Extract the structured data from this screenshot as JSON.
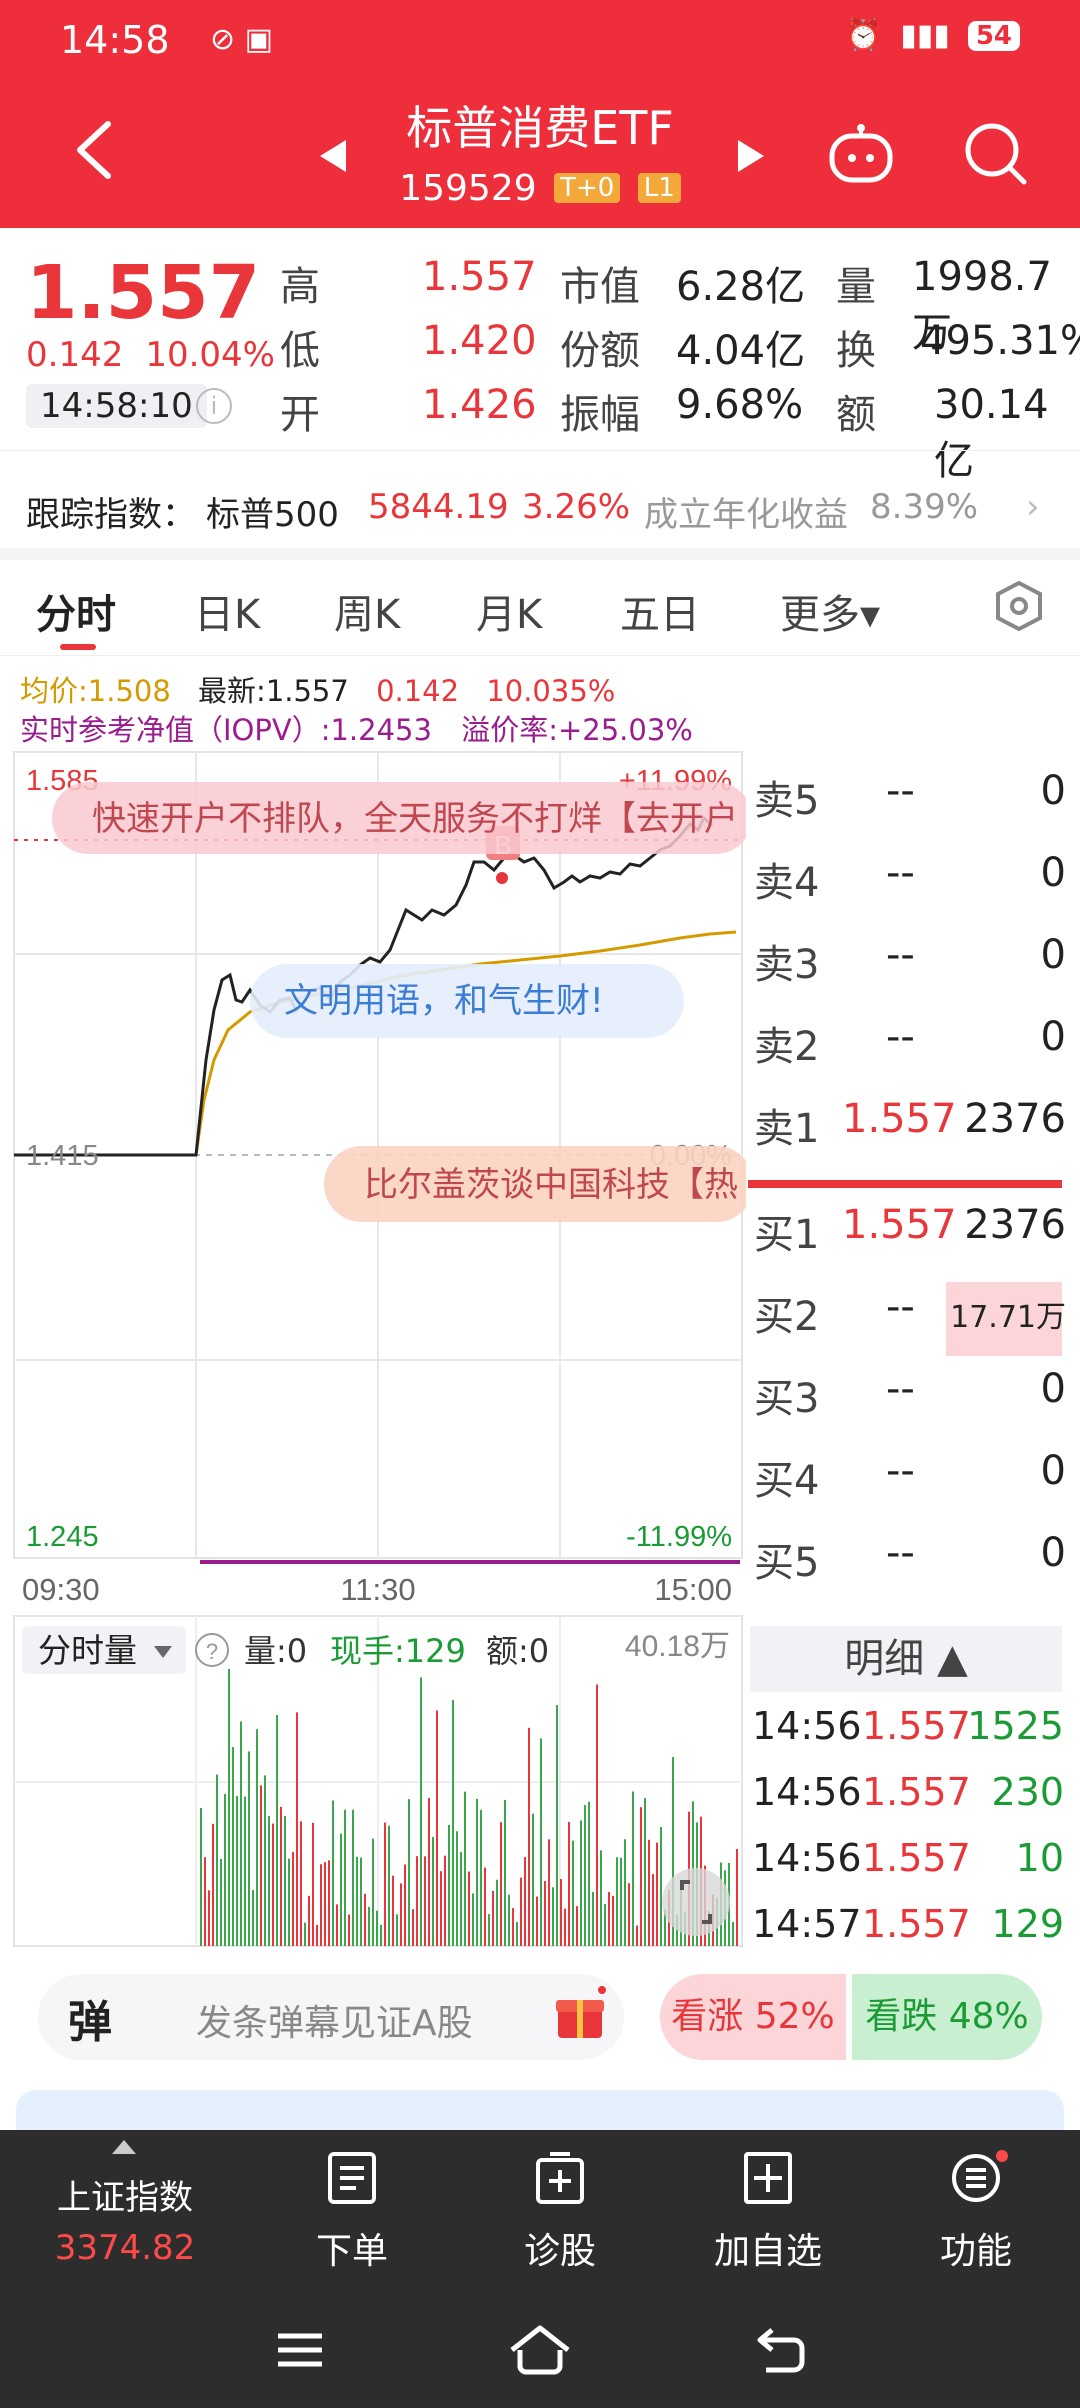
{
  "status": {
    "time": "14:58",
    "battery": "54"
  },
  "header": {
    "title": "标普消费ETF",
    "code": "159529",
    "tags": [
      "T+0",
      "L1"
    ]
  },
  "quote": {
    "price": "1.557",
    "change": "0.142",
    "change_pct": "10.04%",
    "time": "14:58:10",
    "high_label": "高",
    "high": "1.557",
    "low_label": "低",
    "low": "1.420",
    "open_label": "开",
    "open": "1.426",
    "mktcap_label": "市值",
    "mktcap": "6.28亿",
    "share_label": "份额",
    "share": "4.04亿",
    "amp_label": "振幅",
    "amp": "9.68%",
    "vol_label": "量",
    "vol": "1998.7万",
    "turnover_label": "换",
    "turnover": "495.31%",
    "amount_label": "额",
    "amount": "30.14亿"
  },
  "tracking": {
    "label": "跟踪指数：",
    "index": "标普500",
    "value": "5844.19",
    "pct": "3.26%",
    "annual_label": "成立年化收益",
    "annual": "8.39%"
  },
  "tabs": [
    "分时",
    "日K",
    "周K",
    "月K",
    "五日",
    "更多▾"
  ],
  "legend": {
    "avg_label": "均价:",
    "avg": "1.508",
    "latest_label": "最新:",
    "latest": "1.557",
    "chg": "0.142",
    "chg_pct": "10.035%",
    "iopv_label": "实时参考净值（IOPV）:",
    "iopv": "1.2453",
    "premium_label": "溢价率:",
    "premium": "+25.03%"
  },
  "chart": {
    "y_top": "1.585",
    "y_top_pct": "+11.99%",
    "y_mid": "1.415",
    "y_mid_pct": "0.00%",
    "y_bot": "1.245",
    "y_bot_pct": "-11.99%",
    "x_start": "09:30",
    "x_mid": "11:30",
    "x_end": "15:00",
    "marker": "B",
    "danmaku": [
      "快速开户不排队，全天服务不打烊【去开户",
      "文明用语，和气生财!",
      "比尔盖茨谈中国科技【热"
    ],
    "vol_selector": "分时量",
    "vol_label": "量:0",
    "vol_now": "现手:129",
    "amount_label": "额:0",
    "vol_max": "40.18万"
  },
  "orderbook": {
    "asks": [
      {
        "label": "卖5",
        "price": "--",
        "vol": "0"
      },
      {
        "label": "卖4",
        "price": "--",
        "vol": "0"
      },
      {
        "label": "卖3",
        "price": "--",
        "vol": "0"
      },
      {
        "label": "卖2",
        "price": "--",
        "vol": "0"
      },
      {
        "label": "卖1",
        "price": "1.557",
        "vol": "2376"
      }
    ],
    "bids": [
      {
        "label": "买1",
        "price": "1.557",
        "vol": "2376"
      },
      {
        "label": "买2",
        "price": "--",
        "vol": "17.71万"
      },
      {
        "label": "买3",
        "price": "--",
        "vol": "0"
      },
      {
        "label": "买4",
        "price": "--",
        "vol": "0"
      },
      {
        "label": "买5",
        "price": "--",
        "vol": "0"
      }
    ],
    "detail_label": "明细 ▲",
    "trades": [
      {
        "time": "14:56",
        "price": "1.557",
        "vol": "1525"
      },
      {
        "time": "14:56",
        "price": "1.557",
        "vol": "230"
      },
      {
        "time": "14:56",
        "price": "1.557",
        "vol": "10"
      },
      {
        "time": "14:57",
        "price": "1.557",
        "vol": "129"
      }
    ]
  },
  "danmaku_bar": {
    "label": "弹",
    "placeholder": "发条弹幕见证A股",
    "up": "看涨 52%",
    "down": "看跌 48%"
  },
  "bottom_nav": {
    "index_name": "上证指数",
    "index_value": "3374.82",
    "items": [
      "下单",
      "诊股",
      "加自选",
      "功能"
    ]
  }
}
